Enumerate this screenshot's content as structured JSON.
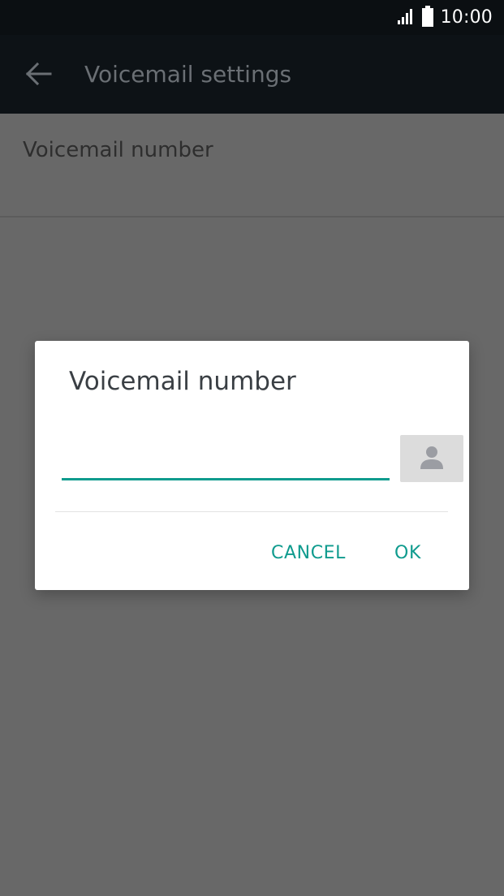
{
  "status_bar": {
    "time": "10:00",
    "signal_icon": "signal-icon",
    "battery_icon": "battery-icon"
  },
  "app_bar": {
    "title": "Voicemail settings",
    "back_icon": "back-arrow-icon"
  },
  "settings": {
    "items": [
      {
        "label": "Voicemail number"
      }
    ]
  },
  "dialog": {
    "title": "Voicemail number",
    "input_value": "",
    "contact_icon": "contact-person-icon",
    "cancel_label": "CANCEL",
    "ok_label": "OK"
  },
  "colors": {
    "accent": "#0f9b8e",
    "status_bar": "#0b0f12",
    "app_bar": "#0d1216",
    "scrim_background": "#686868",
    "dialog_background": "#ffffff"
  }
}
